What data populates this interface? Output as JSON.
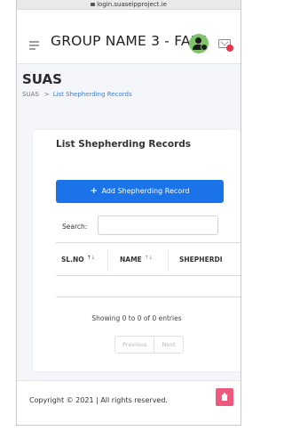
{
  "browser": {
    "url": "login.suaseipproject.ie"
  },
  "header": {
    "title": "GROUP NAME 3 - FAR1",
    "menu_icon": "hamburger-icon",
    "avatar_icon": "user-settings-icon",
    "mail_icon": "envelope-icon",
    "accent_color": "#7fc66a",
    "notification_color": "#e8344a"
  },
  "page": {
    "title": "SUAS",
    "breadcrumb": {
      "root": "SUAS",
      "separator": ">",
      "current": "List Shepherding Records"
    }
  },
  "card": {
    "title": "List Shepherding Records",
    "add_button_label": "Add Shepherding Record",
    "add_button_icon": "plus-icon",
    "search_label": "Search:",
    "search_value": "",
    "table": {
      "columns": [
        "SL.NO",
        "NAME",
        "SHEPHERDI"
      ],
      "rows": []
    },
    "info": "Showing 0 to 0 of 0 entries",
    "pagination": {
      "previous": "Previous",
      "next": "Next"
    },
    "button_color": "#1a73e8"
  },
  "footer": {
    "copyright": "Copyright © 2021 | All rights reserved.",
    "home_icon": "home-icon",
    "home_color": "#ee5a7d"
  }
}
